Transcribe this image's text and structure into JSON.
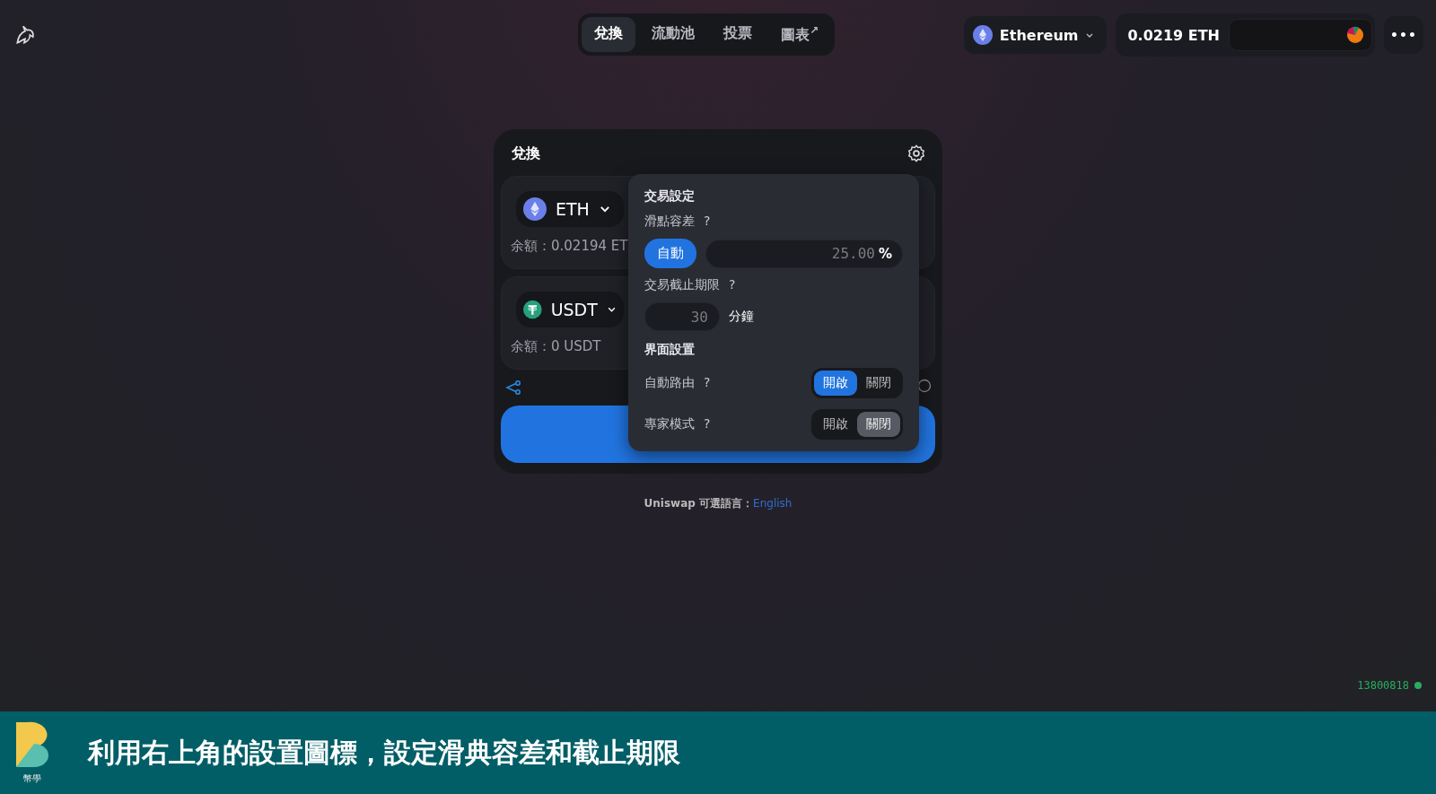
{
  "nav": {
    "tabs": [
      {
        "label": "兌換",
        "selected": true
      },
      {
        "label": "流動池",
        "selected": false
      },
      {
        "label": "投票",
        "selected": false
      },
      {
        "label": "圖表",
        "selected": false,
        "suffix": "↗"
      }
    ]
  },
  "network": {
    "label": "Ethereum"
  },
  "account": {
    "balance": "0.0219 ETH"
  },
  "more": "•••",
  "swap": {
    "title": "兌換",
    "inputs": [
      {
        "kind": "eth",
        "token": "ETH",
        "balance": "余額：0.02194 ET"
      },
      {
        "kind": "tether",
        "token": "USDT",
        "balance": "余額：0 USDT"
      }
    ]
  },
  "settings": {
    "title": "交易設定",
    "slippage": {
      "label": "滑點容差",
      "help": "?",
      "auto": {
        "label": "自動",
        "selected": true
      },
      "value": "25.00",
      "unit": "%"
    },
    "deadline": {
      "label": "交易截止期限",
      "help": "?",
      "value": "30",
      "unit": "分鐘"
    },
    "interface_title": "界面設置",
    "toggles": [
      {
        "label": "自動路由",
        "help": "?",
        "options": [
          {
            "label": "開啟",
            "selected": true
          },
          {
            "label": "關閉",
            "selected": false
          }
        ]
      },
      {
        "label": "專家模式",
        "help": "?",
        "options": [
          {
            "label": "開啟",
            "selected": false
          },
          {
            "label": "關閉",
            "selected": true
          }
        ]
      }
    ]
  },
  "footer": {
    "language": "Uniswap 可選語言：",
    "link": "English"
  },
  "block": {
    "number": "13800818",
    "color": "#27ae60"
  },
  "banner": {
    "logo_label": "幣學",
    "caption": "利用右上角的設置圖標，設定滑典容差和截止期限"
  }
}
